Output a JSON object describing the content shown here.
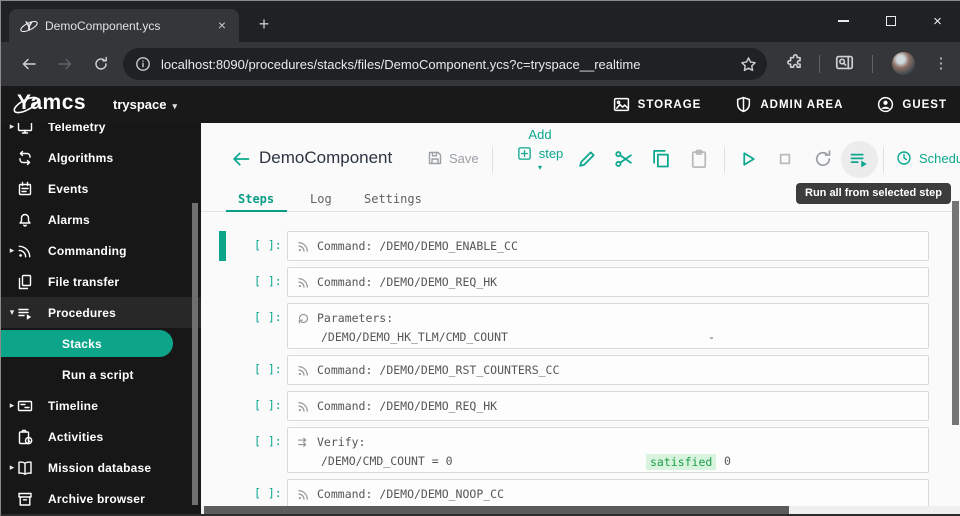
{
  "browser": {
    "tab_title": "DemoComponent.ycs",
    "tab_close_glyph": "×",
    "new_tab_glyph": "+",
    "url": "localhost:8090/procedures/stacks/files/DemoComponent.ycs?c=tryspace__realtime",
    "menu_glyph": "⋮",
    "window_close_glyph": "×"
  },
  "header": {
    "logo": "Yamcs",
    "instance": "tryspace",
    "instance_caret": "▾",
    "links": [
      {
        "label": "STORAGE",
        "icon": "storage-icon"
      },
      {
        "label": "ADMIN AREA",
        "icon": "shield-icon"
      },
      {
        "label": "GUEST",
        "icon": "person-circle-icon"
      }
    ]
  },
  "sidebar": {
    "items": [
      {
        "label": "Telemetry",
        "icon": "monitor",
        "expandable": true,
        "expanded": false
      },
      {
        "label": "Algorithms",
        "icon": "transform"
      },
      {
        "label": "Events",
        "icon": "calendar"
      },
      {
        "label": "Alarms",
        "icon": "bell"
      },
      {
        "label": "Commanding",
        "icon": "rss",
        "expandable": true,
        "expanded": false
      },
      {
        "label": "File transfer",
        "icon": "file-copy"
      },
      {
        "label": "Procedures",
        "icon": "playlist-play",
        "expandable": true,
        "expanded": true,
        "highlighted": true
      },
      {
        "label": "Stacks",
        "child": true,
        "active": true
      },
      {
        "label": "Run a script",
        "child": true
      },
      {
        "label": "Timeline",
        "icon": "timeline",
        "expandable": true,
        "expanded": false
      },
      {
        "label": "Activities",
        "icon": "clipboard-clock"
      },
      {
        "label": "Mission database",
        "icon": "book",
        "expandable": true,
        "expanded": false
      },
      {
        "label": "Archive browser",
        "icon": "archive"
      }
    ]
  },
  "page": {
    "title": "DemoComponent",
    "toolbar": {
      "save_label": "Save",
      "add_line1": "Add",
      "add_line2": "step",
      "add_caret": "▾",
      "schedule_label": "Schedu"
    },
    "tooltip": "Run all from selected step",
    "tabs": [
      {
        "label": "Steps",
        "active": true
      },
      {
        "label": "Log",
        "active": false
      },
      {
        "label": "Settings",
        "active": false
      }
    ]
  },
  "steps": [
    {
      "kind": "command",
      "icon": "rss",
      "prefix": "[ ]:",
      "label": "Command:",
      "value": "/DEMO/DEMO_ENABLE_CC",
      "selected": true
    },
    {
      "kind": "command",
      "icon": "rss",
      "prefix": "[ ]:",
      "label": "Command:",
      "value": "/DEMO/DEMO_REQ_HK"
    },
    {
      "kind": "parameters",
      "icon": "history",
      "prefix": "[ ]:",
      "label": "Parameters:",
      "rows": [
        {
          "name": "/DEMO/DEMO_HK_TLM/CMD_COUNT",
          "value": "-"
        }
      ]
    },
    {
      "kind": "command",
      "icon": "rss",
      "prefix": "[ ]:",
      "label": "Command:",
      "value": "/DEMO/DEMO_RST_COUNTERS_CC"
    },
    {
      "kind": "command",
      "icon": "rss",
      "prefix": "[ ]:",
      "label": "Command:",
      "value": "/DEMO/DEMO_REQ_HK"
    },
    {
      "kind": "verify",
      "icon": "verify",
      "prefix": "[ ]:",
      "label": "Verify:",
      "condition": "/DEMO/CMD_COUNT = 0",
      "status": "satisfied",
      "status_value": "0"
    },
    {
      "kind": "command",
      "icon": "rss",
      "prefix": "[ ]:",
      "label": "Command:",
      "value": "/DEMO/DEMO_NOOP_CC"
    }
  ],
  "colors": {
    "accent": "#0ba78e",
    "sidebar_active": "#0ca58a",
    "satisfied_text": "#1d9e4b",
    "satisfied_bg": "#d9f4de"
  }
}
